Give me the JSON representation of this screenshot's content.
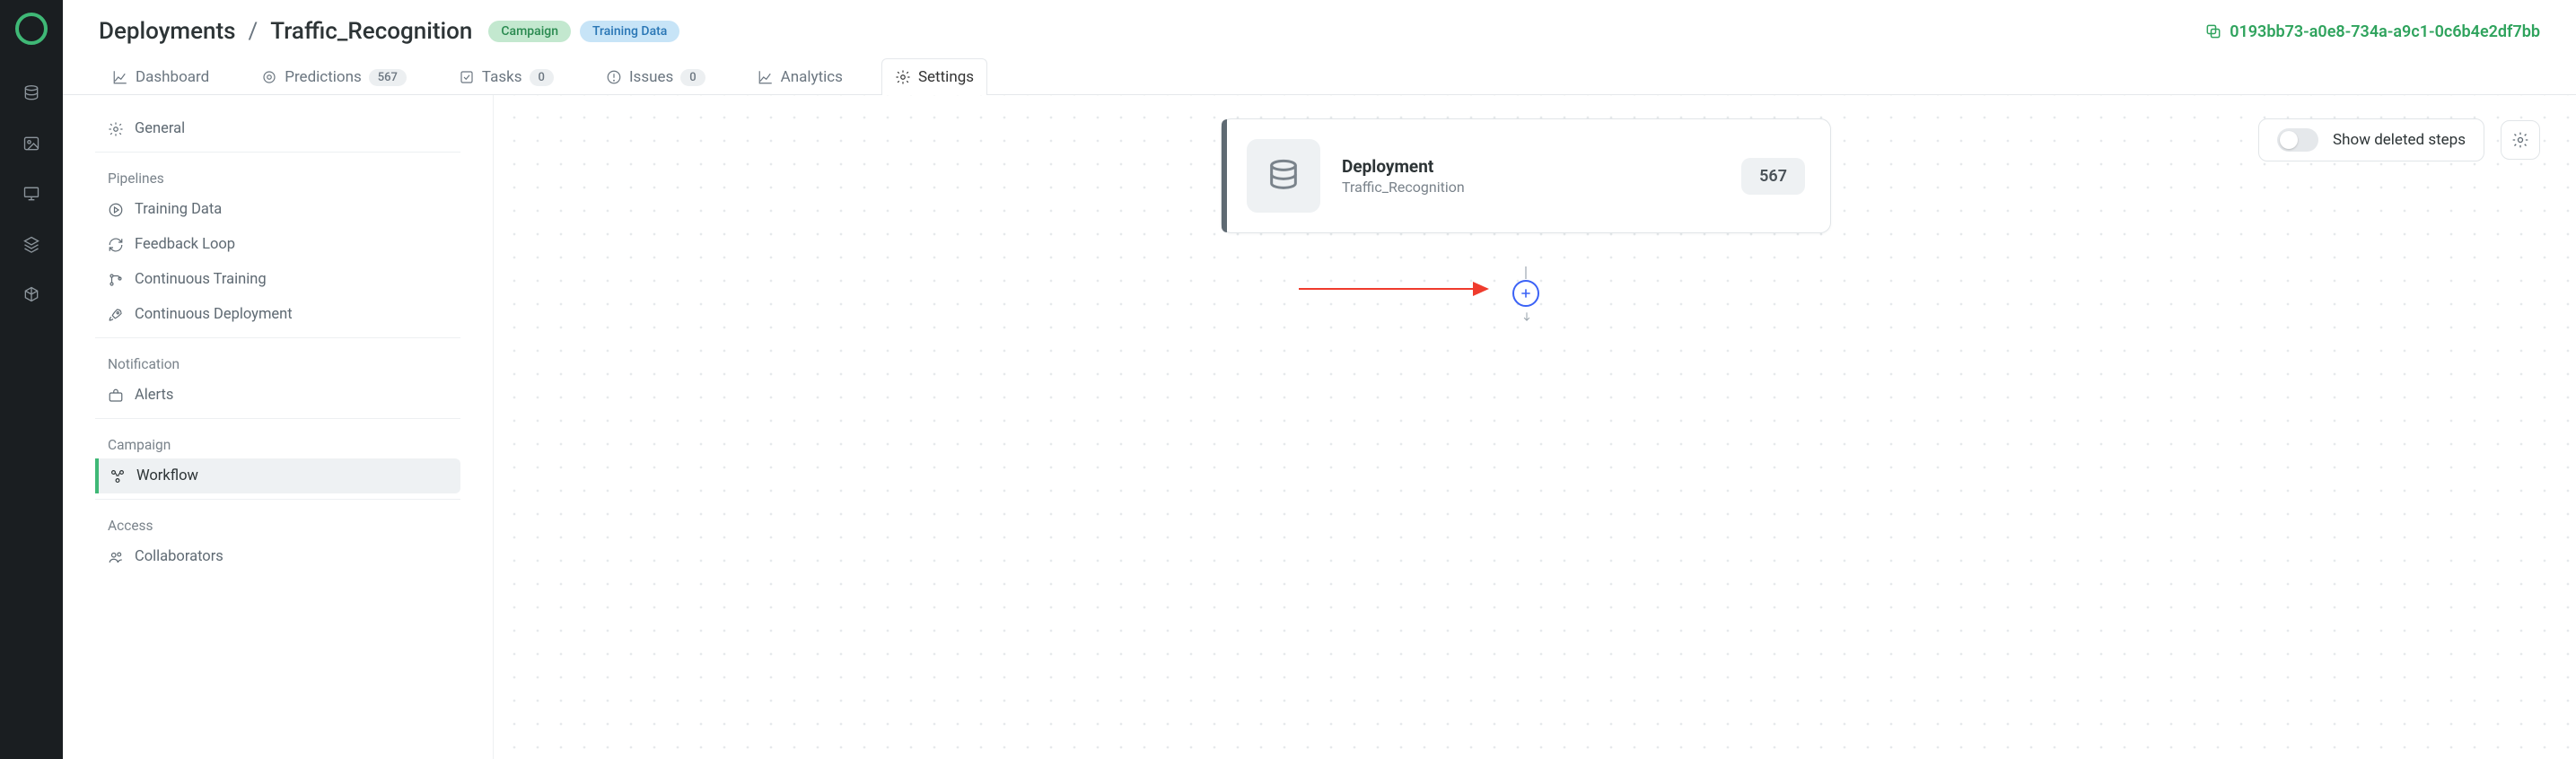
{
  "header": {
    "breadcrumb_root": "Deployments",
    "breadcrumb_sep": "/",
    "breadcrumb_leaf": "Traffic_Recognition",
    "tag_campaign": "Campaign",
    "tag_training": "Training Data",
    "deploy_id": "0193bb73-a0e8-734a-a9c1-0c6b4e2df7bb"
  },
  "tabs": {
    "dashboard": "Dashboard",
    "predictions": "Predictions",
    "predictions_count": "567",
    "tasks": "Tasks",
    "tasks_count": "0",
    "issues": "Issues",
    "issues_count": "0",
    "analytics": "Analytics",
    "settings": "Settings"
  },
  "sidebar": {
    "general": "General",
    "group_pipelines": "Pipelines",
    "training_data": "Training Data",
    "feedback_loop": "Feedback Loop",
    "continuous_training": "Continuous Training",
    "continuous_deployment": "Continuous Deployment",
    "group_notification": "Notification",
    "alerts": "Alerts",
    "group_campaign": "Campaign",
    "workflow": "Workflow",
    "group_access": "Access",
    "collaborators": "Collaborators"
  },
  "canvas": {
    "toggle_label": "Show deleted steps",
    "node_title": "Deployment",
    "node_subtitle": "Traffic_Recognition",
    "node_count": "567"
  }
}
